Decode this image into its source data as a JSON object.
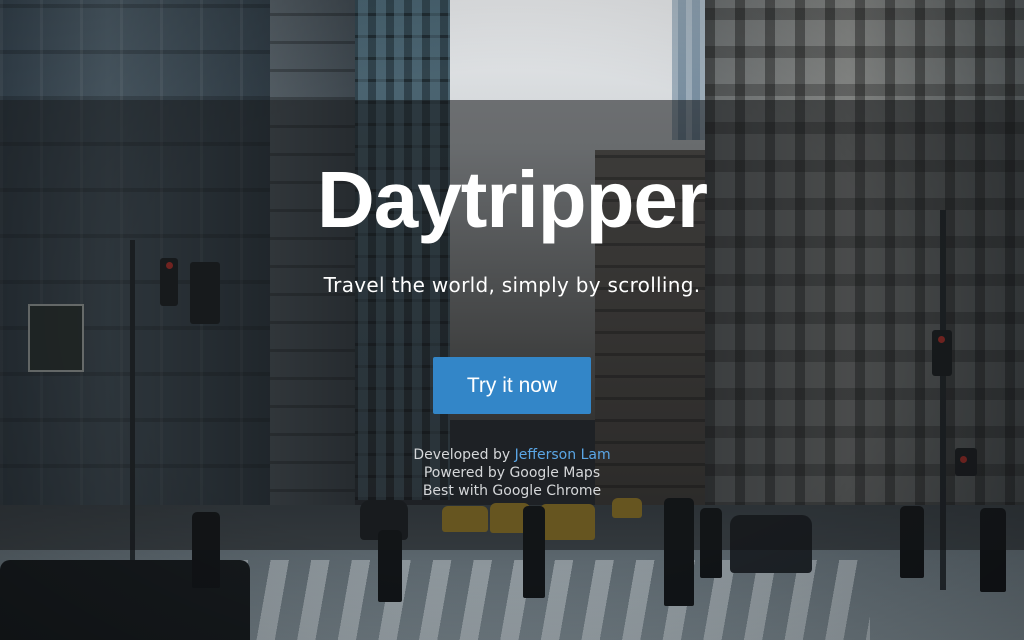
{
  "hero": {
    "title": "Daytripper",
    "tagline": "Travel the world, simply by scrolling.",
    "cta_label": "Try it now"
  },
  "credits": {
    "developed_prefix": "Developed by",
    "developer_name": "Jefferson Lam",
    "powered_by": "Powered by Google Maps",
    "best_with": "Best with Google Chrome"
  },
  "colors": {
    "cta_background": "#3386c8",
    "link": "#5aa6e6",
    "title": "#ffffff"
  }
}
